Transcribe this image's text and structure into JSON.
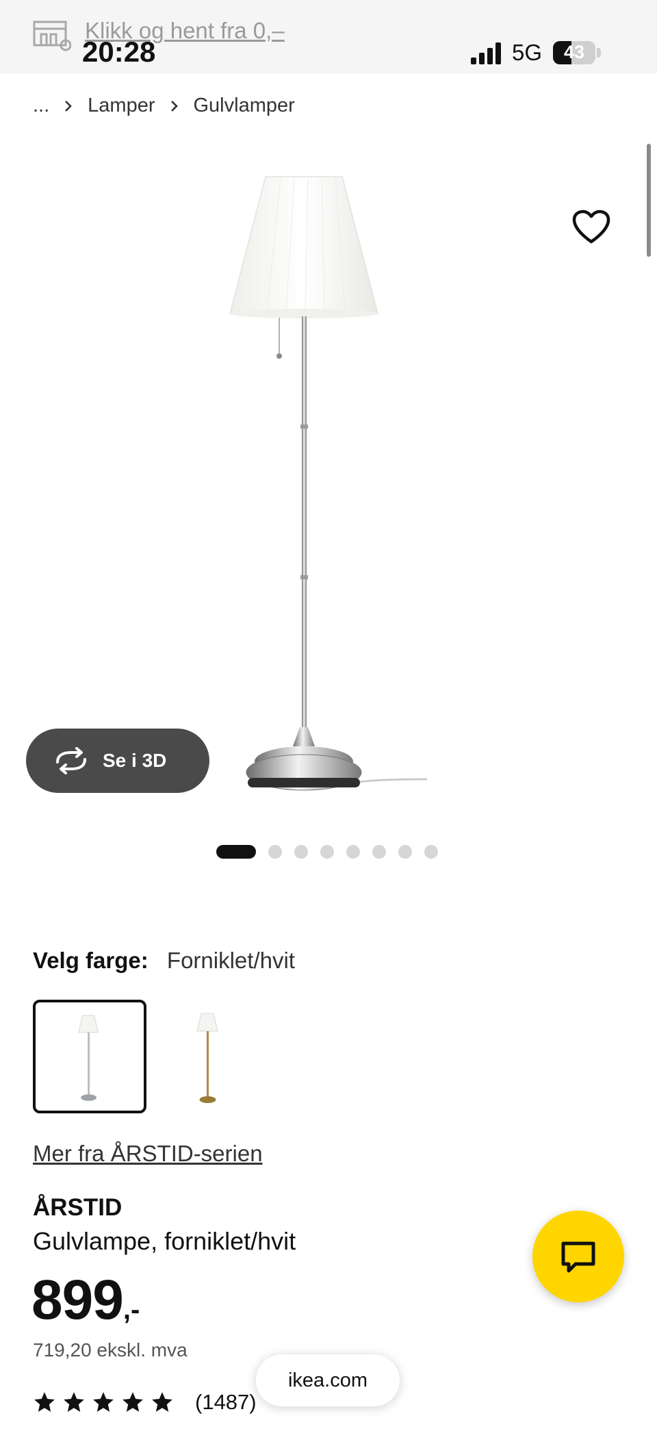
{
  "status_bar": {
    "time": "20:28",
    "network": "5G",
    "battery": "43",
    "battery_level_percent": 43,
    "promo_text": "Klikk og hent fra 0,–"
  },
  "breadcrumb": [
    "...",
    "Lamper",
    "Gulvlamper"
  ],
  "gallery": {
    "view_3d_label": "Se i 3D",
    "image_count": 8,
    "active_index": 0
  },
  "color_picker": {
    "label": "Velg farge:",
    "selected": "Forniklet/hvit",
    "variants": [
      {
        "icon": "nickel-floor-lamp-thumbnail",
        "color": "#b9bcbf"
      },
      {
        "icon": "brass-floor-lamp-thumbnail",
        "color": "#b08a3e"
      }
    ]
  },
  "series_link": "Mer fra ÅRSTID-serien",
  "product": {
    "name": "ÅRSTID",
    "description": "Gulvlampe, forniklet/hvit",
    "price_main": "899",
    "price_suffix": ",-",
    "price_ex_vat": "719,20 ekskl. mva",
    "rating_stars": 5,
    "review_count": "(1487)"
  },
  "url_bar": "ikea.com",
  "colors": {
    "accent_yellow": "#ffd500",
    "button_3d_bg": "#4a4a4a",
    "text_dark": "#111111"
  }
}
